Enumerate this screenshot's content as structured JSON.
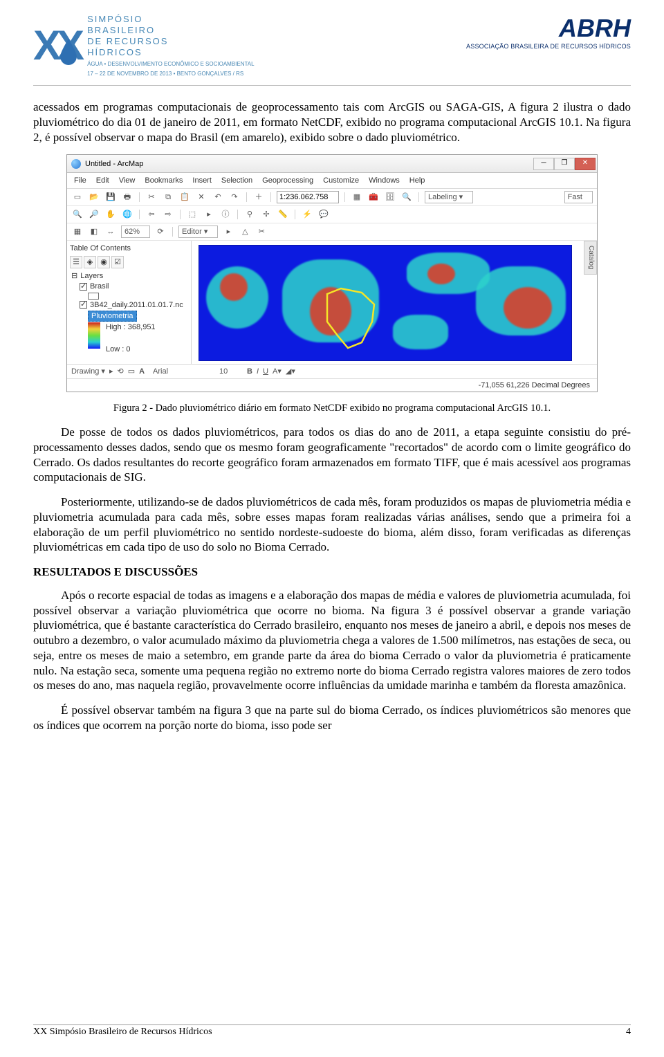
{
  "header": {
    "left_title_1": "SIMPÓSIO",
    "left_title_2": "BRASILEIRO",
    "left_title_3": "DE RECURSOS",
    "left_title_4": "HÍDRICOS",
    "left_sub_1": "ÁGUA • DESENVOLVIMENTO ECONÔMICO E SOCIOAMBIENTAL",
    "left_sub_2": "17 – 22 DE NOVEMBRO DE 2013 • BENTO GONÇALVES / RS",
    "right_main": "ABRH",
    "right_sub": "ASSOCIAÇÃO BRASILEIRA DE RECURSOS HÍDRICOS"
  },
  "body": {
    "para1": "acessados em programas computacionais de geoprocessamento tais com ArcGIS ou SAGA-GIS, A figura 2 ilustra o dado pluviométrico do dia 01 de janeiro de 2011, em formato NetCDF, exibido no programa computacional ArcGIS 10.1. Na figura 2, é possível observar o mapa do Brasil (em amarelo), exibido sobre o dado pluviométrico.",
    "fig_caption": "Figura 2 - Dado pluviométrico diário em formato NetCDF exibido no programa computacional ArcGIS 10.1.",
    "para2": "De posse de todos os dados pluviométricos, para todos os dias do ano de 2011, a etapa seguinte consistiu do pré-processamento desses dados, sendo que os mesmo foram geograficamente \"recortados\" de acordo com o limite geográfico do Cerrado. Os dados resultantes do recorte geográfico foram armazenados em formato TIFF, que é mais acessível aos programas computacionais de SIG.",
    "para3": "Posteriormente, utilizando-se de dados pluviométricos de cada mês, foram produzidos os mapas de pluviometria média e pluviometria acumulada para cada mês, sobre esses mapas foram realizadas várias análises, sendo que a primeira foi a elaboração de um perfil pluviométrico no sentido nordeste-sudoeste do bioma, além disso, foram verificadas as diferenças pluviométricas em cada tipo de uso do solo no Bioma Cerrado.",
    "section": "RESULTADOS E DISCUSSÕES",
    "para4": "Após o recorte espacial de todas as imagens e a elaboração dos mapas de média e valores de pluviometria acumulada, foi possível observar a variação pluviométrica que ocorre no bioma. Na figura 3 é possível observar a grande variação pluviométrica, que é bastante característica do Cerrado brasileiro, enquanto nos meses de janeiro a abril, e depois nos meses de outubro a dezembro, o valor acumulado máximo da pluviometria chega a valores de 1.500 milímetros, nas estações de seca, ou seja, entre os meses de maio a setembro, em grande parte da área do bioma Cerrado o valor da pluviometria é praticamente nulo. Na estação seca, somente uma pequena região no extremo norte do bioma Cerrado registra valores maiores de zero todos os meses do ano, mas naquela região, provavelmente ocorre influências da umidade marinha e também da floresta amazônica.",
    "para5": "É possível observar também na figura 3 que na parte sul do bioma Cerrado, os índices pluviométricos são menores que os índices que ocorrem na porção norte do bioma, isso pode ser"
  },
  "figure": {
    "window_title": "Untitled - ArcMap",
    "menu": [
      "File",
      "Edit",
      "View",
      "Bookmarks",
      "Insert",
      "Selection",
      "Geoprocessing",
      "Customize",
      "Windows",
      "Help"
    ],
    "scale": "1:236.062.758",
    "labeling": "Labeling ▾",
    "zoom": "62%",
    "editor": "Editor ▾",
    "fast": "Fast",
    "toc_title": "Table Of Contents",
    "layers": "Layers",
    "layer1": "Brasil",
    "layer2": "3B42_daily.2011.01.01.7.nc",
    "layer2_band": "Pluviometria",
    "legend_high": "High : 368,951",
    "legend_low": "Low : 0",
    "drawing": "Drawing ▾",
    "font": "Arial",
    "font_size": "10",
    "status": "-71,055  61,226 Decimal Degrees",
    "catalog": "Catalog"
  },
  "footer": {
    "left": "XX Simpósio Brasileiro de Recursos Hídricos",
    "page": "4"
  }
}
